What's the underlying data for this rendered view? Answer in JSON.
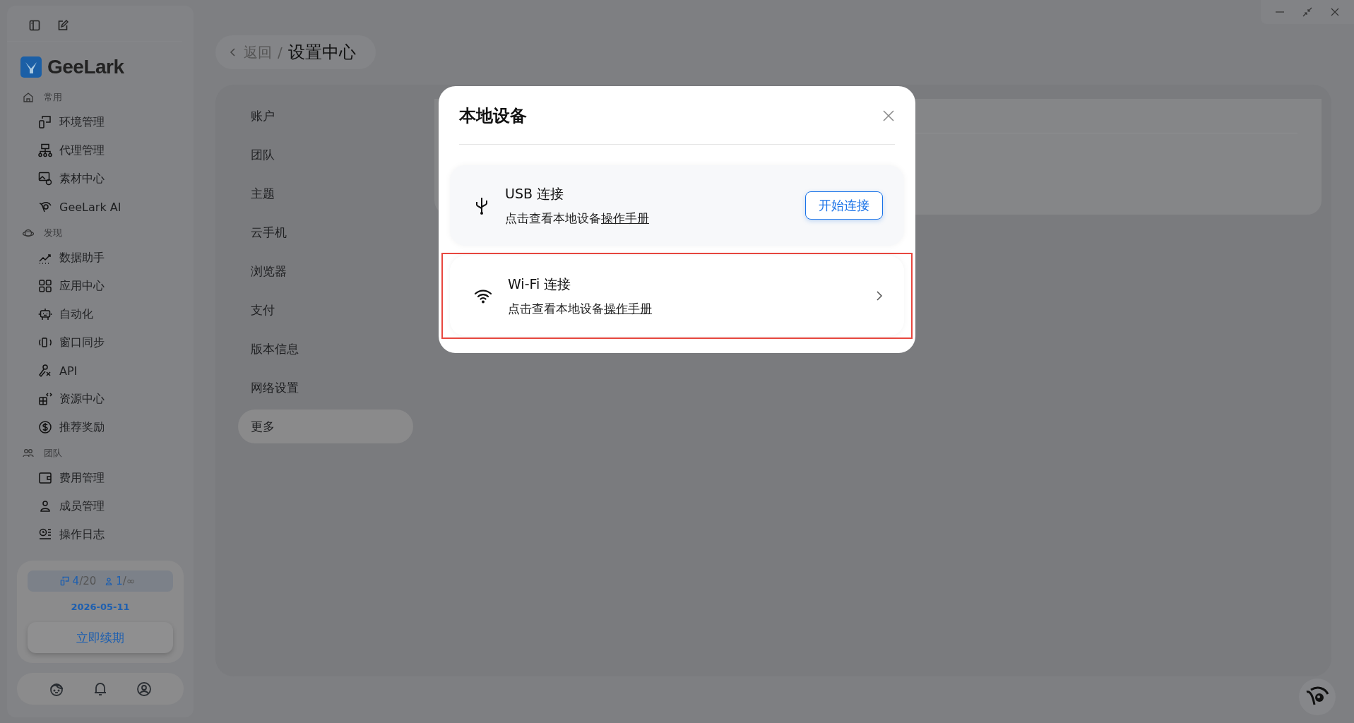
{
  "brand": {
    "name": "GeeLark"
  },
  "sidebar": {
    "sections": [
      {
        "label": "常用",
        "items": [
          {
            "label": "环境管理"
          },
          {
            "label": "代理管理"
          },
          {
            "label": "素材中心"
          },
          {
            "label": "GeeLark AI"
          }
        ]
      },
      {
        "label": "发现",
        "items": [
          {
            "label": "数据助手"
          },
          {
            "label": "应用中心"
          },
          {
            "label": "自动化"
          },
          {
            "label": "窗口同步"
          },
          {
            "label": "API"
          },
          {
            "label": "资源中心"
          },
          {
            "label": "推荐奖励"
          }
        ]
      },
      {
        "label": "团队",
        "items": [
          {
            "label": "费用管理"
          },
          {
            "label": "成员管理"
          },
          {
            "label": "操作日志"
          }
        ]
      }
    ]
  },
  "plan": {
    "devices_used": "4",
    "devices_total": "/20",
    "members_used": "1",
    "members_total": "/∞",
    "expiry": "2026-05-11",
    "renew_button": "立即续期"
  },
  "breadcrumb": {
    "back": "返回",
    "separator": "/",
    "current": "设置中心"
  },
  "settings_menu": [
    {
      "label": "账户",
      "selected": false
    },
    {
      "label": "团队",
      "selected": false
    },
    {
      "label": "主题",
      "selected": false
    },
    {
      "label": "云手机",
      "selected": false
    },
    {
      "label": "浏览器",
      "selected": false
    },
    {
      "label": "支付",
      "selected": false
    },
    {
      "label": "版本信息",
      "selected": false
    },
    {
      "label": "网络设置",
      "selected": false
    },
    {
      "label": "更多",
      "selected": true
    }
  ],
  "dialog": {
    "title": "本地设备",
    "options": [
      {
        "kind": "button",
        "title": "USB 连接",
        "desc": "点击查看本地设备",
        "link": "操作手册",
        "action": "开始连接",
        "highlighted": false
      },
      {
        "kind": "chevron",
        "title": "Wi-Fi 连接",
        "desc": "点击查看本地设备",
        "link": "操作手册",
        "highlighted": true
      }
    ]
  }
}
